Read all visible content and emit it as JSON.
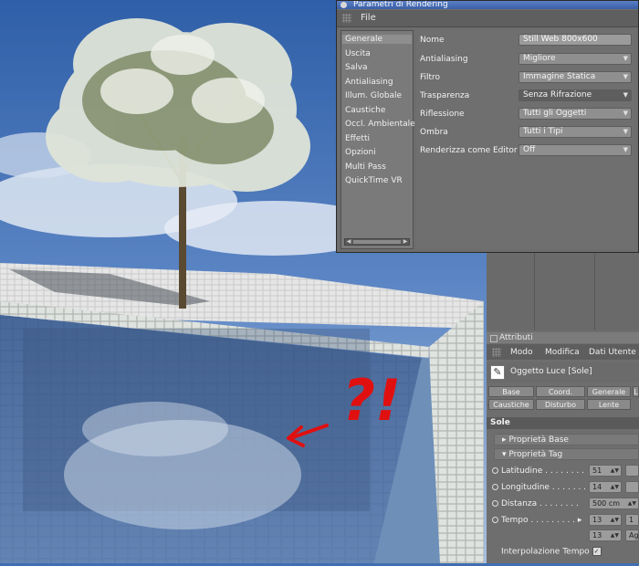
{
  "dialog": {
    "title": "Parametri di Rendering",
    "menu_file": "File",
    "nav": [
      "Generale",
      "Uscita",
      "Salva",
      "Antialiasing",
      "Illum. Globale",
      "Caustiche",
      "Occl. Ambientale",
      "Effetti",
      "Opzioni",
      "Multi Pass",
      "QuickTime VR"
    ],
    "fields": [
      {
        "label": "Nome",
        "value": "Still Web 800x600"
      },
      {
        "label": "Antialiasing",
        "value": "Migliore"
      },
      {
        "label": "Filtro",
        "value": "Immagine Statica"
      },
      {
        "label": "Trasparenza",
        "value": "Senza Rifrazione"
      },
      {
        "label": "Riflessione",
        "value": "Tutti gli Oggetti"
      },
      {
        "label": "Ombra",
        "value": "Tutti i Tipi"
      },
      {
        "label": "Renderizza come Editor",
        "value": "Off"
      }
    ]
  },
  "attributes": {
    "title": "Attributi",
    "menu": [
      "Modo",
      "Modifica",
      "Dati Utente"
    ],
    "object": "Oggetto Luce [Sole]",
    "tabs_row1": [
      "Base",
      "Coord.",
      "Generale",
      "L"
    ],
    "tabs_row2": [
      "Caustiche",
      "Disturbo",
      "Lente"
    ],
    "section": "Sole",
    "sub1": "Proprietà Base",
    "sub2": "Proprietà Tag",
    "params": [
      {
        "label": "Latitudine",
        "value": "51"
      },
      {
        "label": "Longitudine",
        "value": "14"
      },
      {
        "label": "Distanza",
        "value": "500 cm"
      },
      {
        "label": "Tempo",
        "value": "13"
      }
    ],
    "time_extra_1": "1",
    "time_row2_value": "13",
    "time_row2_button": "Ag",
    "interp_label": "Interpolazione Tempo",
    "interp_checked": "✓"
  },
  "annotation": {
    "text": "?!"
  },
  "colors": {
    "annotation_red": "#e01010",
    "sky": "#3f6fb0",
    "water": "#4a6fa8"
  }
}
